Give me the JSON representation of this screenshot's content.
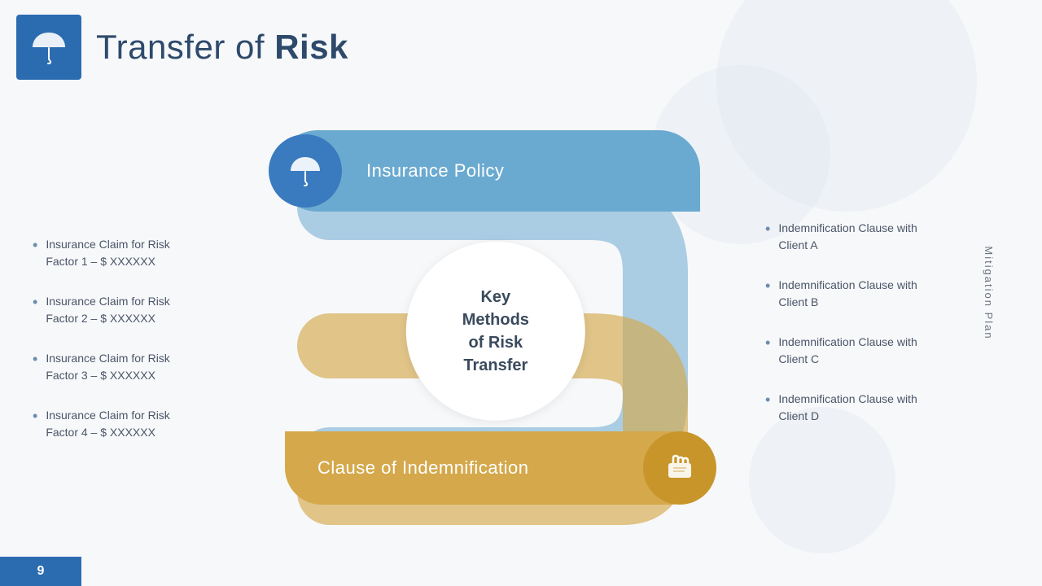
{
  "header": {
    "title_normal": "Transfer of ",
    "title_bold": "Risk",
    "icon": "umbrella"
  },
  "insurance_policy": {
    "label": "Insurance Policy",
    "icon": "umbrella"
  },
  "center_circle": {
    "line1": "Key",
    "line2": "Methods",
    "line3": "of Risk",
    "line4": "Transfer"
  },
  "indemnification": {
    "label": "Clause of Indemnification",
    "icon": "hand"
  },
  "left_bullets": {
    "items": [
      "Insurance Claim for Risk\nFactor 1 – $ XXXXXX",
      "Insurance Claim for Risk\nFactor 2 – $ XXXXXX",
      "Insurance Claim for Risk\nFactor 3 – $ XXXXXX",
      "Insurance Claim for Risk\nFactor 4 – $ XXXXXX"
    ]
  },
  "right_bullets": {
    "items": [
      "Indemnification Clause with\nClient A",
      "Indemnification Clause with\nClient B",
      "Indemnification Clause with\nClient C",
      "Indemnification Clause with\nClient D"
    ]
  },
  "side_label": "Mitigation Plan",
  "page_number": "9",
  "colors": {
    "blue_dark": "#2b6cb0",
    "blue_medium": "#6baad0",
    "gold": "#d4a84b",
    "text_dark": "#2d4a6b",
    "text_body": "#4a5568"
  }
}
